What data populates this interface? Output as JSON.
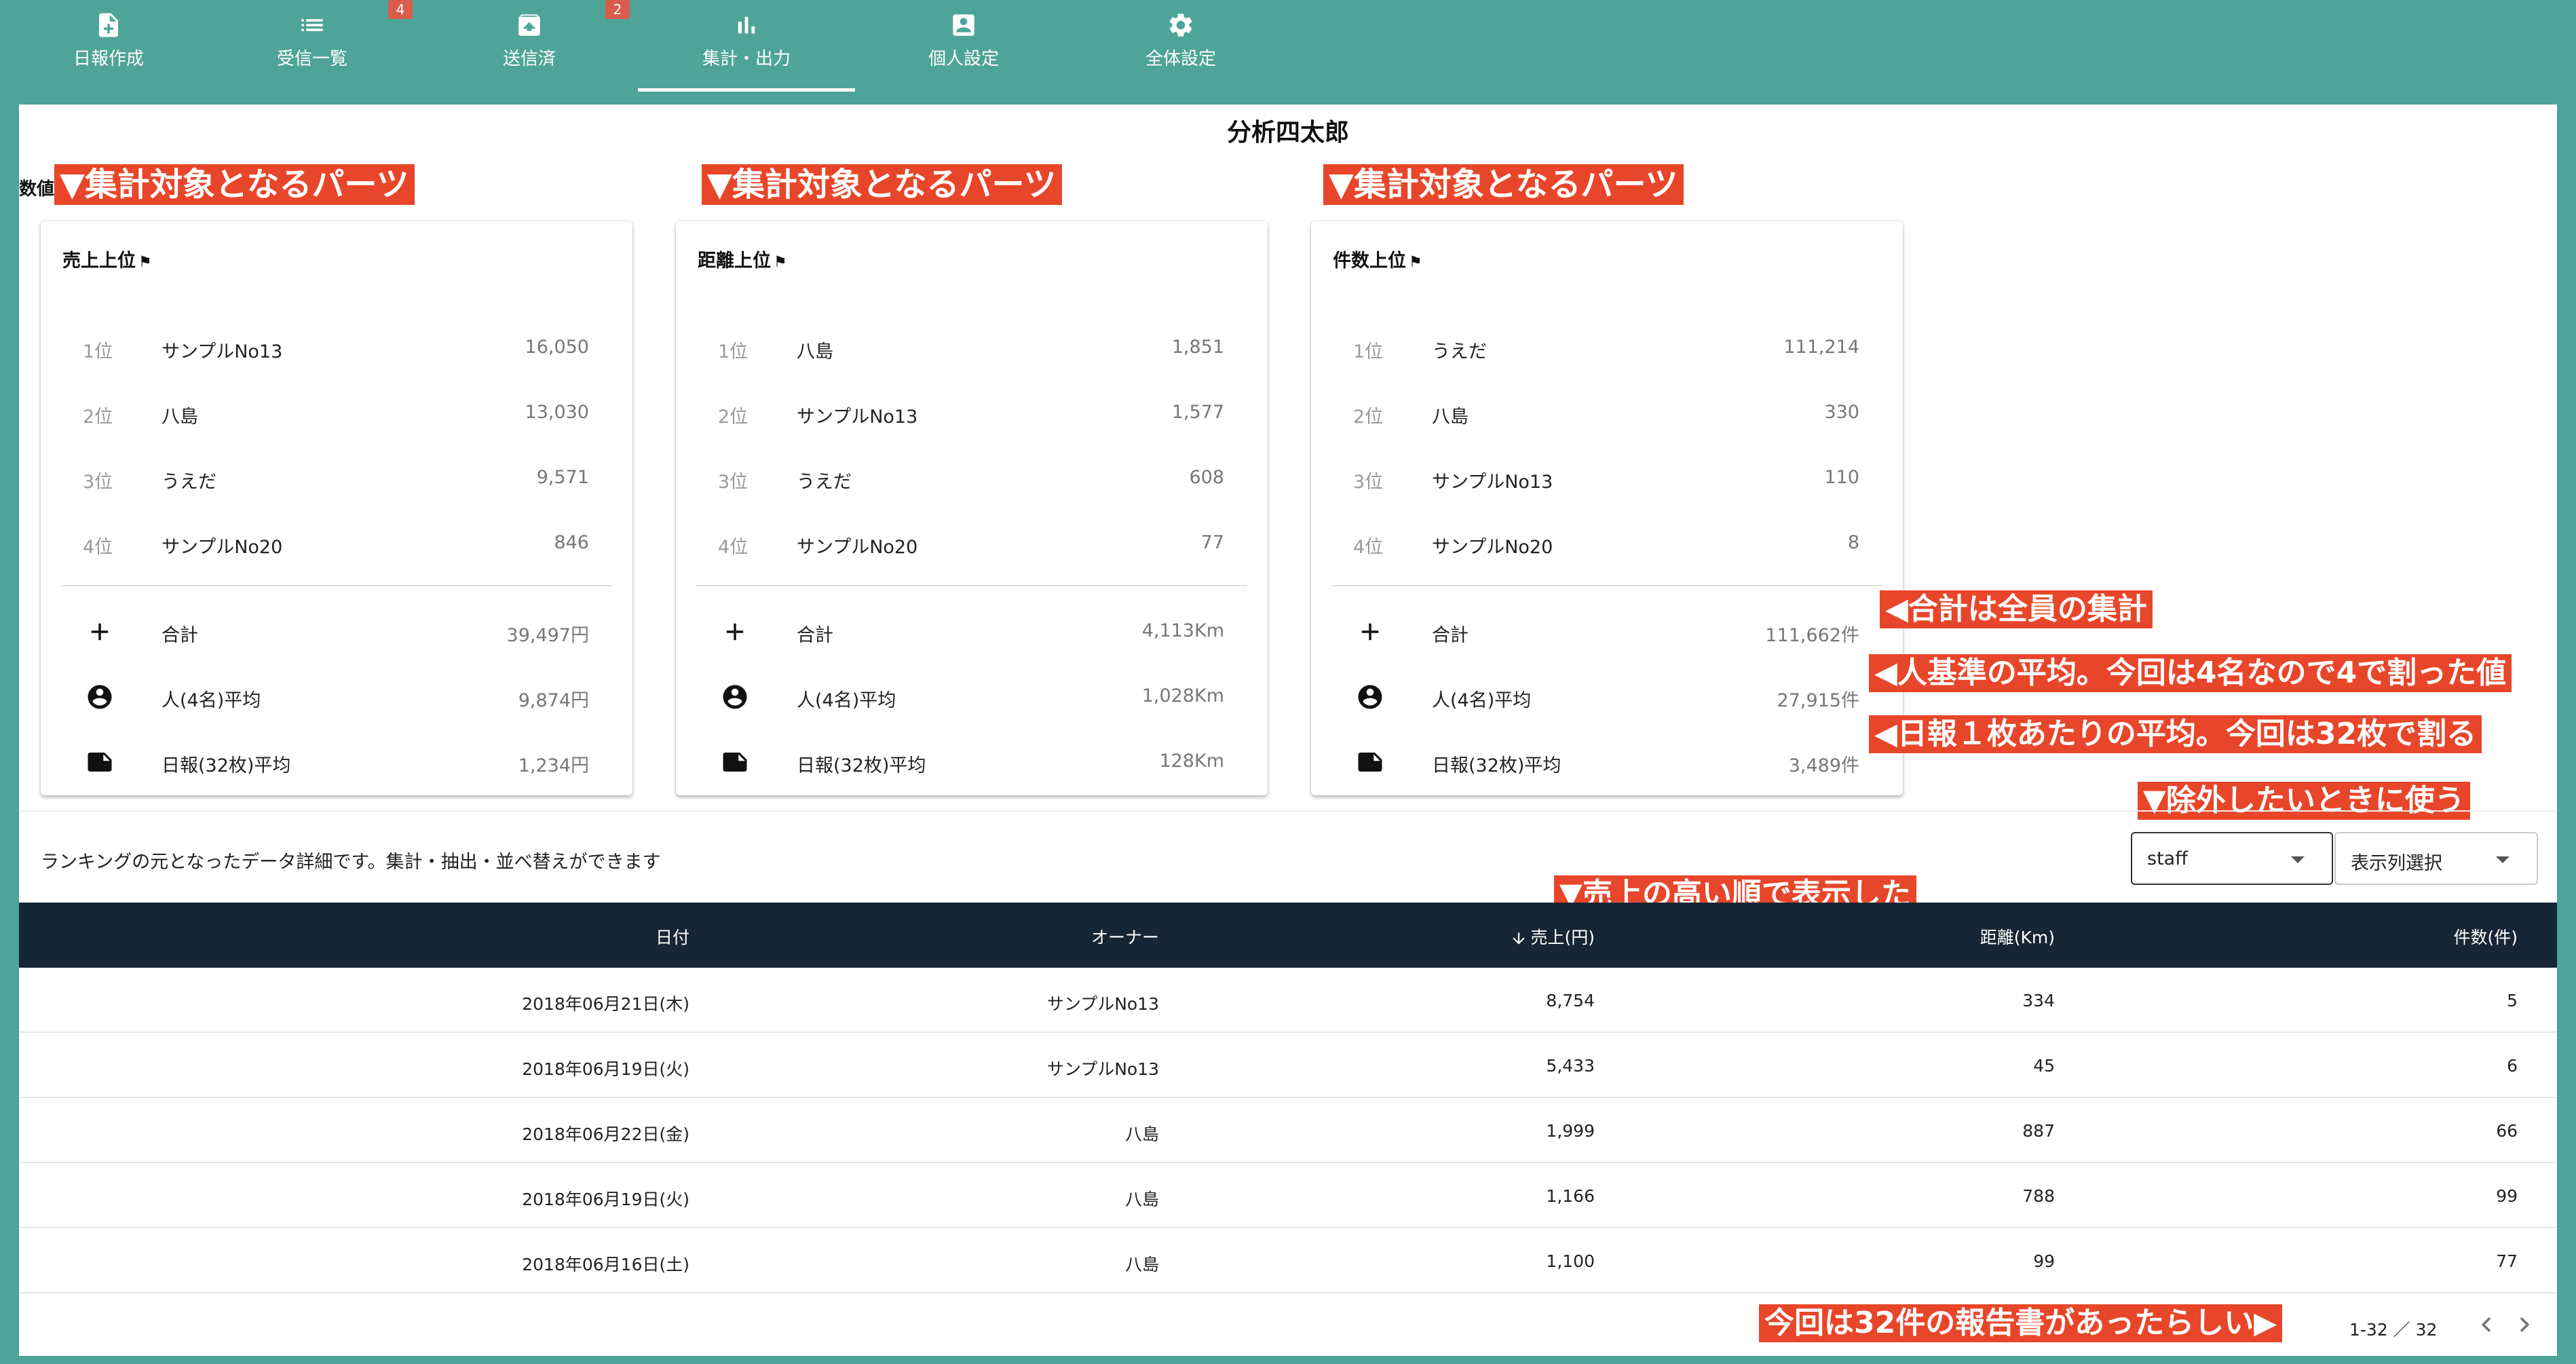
{
  "nav": {
    "items": [
      {
        "label": "日報作成",
        "icon": "note-add-icon"
      },
      {
        "label": "受信一覧",
        "icon": "list-icon",
        "badge": "4"
      },
      {
        "label": "送信済",
        "icon": "archive-icon",
        "badge": "2"
      },
      {
        "label": "集計・出力",
        "icon": "bar-chart-icon",
        "active": true
      },
      {
        "label": "個人設定",
        "icon": "account-box-icon"
      },
      {
        "label": "全体設定",
        "icon": "gear-icon"
      }
    ]
  },
  "page": {
    "title": "分析四太郎",
    "section_label": "数値"
  },
  "annotations": {
    "parts": "▼集計対象となるパーツ",
    "total": "◀合計は全員の集計",
    "person_avg": "◀人基準の平均。今回は4名なので4で割った値",
    "report_avg": "◀日報１枚あたりの平均。今回は32枚で割る",
    "exclude": "▼除外したいときに使う",
    "sorted": "▼売上の高い順で表示した",
    "reports": "今回は32件の報告書があったらしい▶"
  },
  "cards": [
    {
      "title": "売上上位",
      "ranks": [
        {
          "rank": "1位",
          "name": "サンプルNo13",
          "value": "16,050"
        },
        {
          "rank": "2位",
          "name": "八島",
          "value": "13,030"
        },
        {
          "rank": "3位",
          "name": "うえだ",
          "value": "9,571"
        },
        {
          "rank": "4位",
          "name": "サンプルNo20",
          "value": "846"
        }
      ],
      "summary": [
        {
          "label": "合計",
          "value": "39,497円",
          "icon": "plus-icon"
        },
        {
          "label": "人(4名)平均",
          "value": "9,874円",
          "icon": "account-circle-icon"
        },
        {
          "label": "日報(32枚)平均",
          "value": "1,234円",
          "icon": "note-icon"
        }
      ]
    },
    {
      "title": "距離上位",
      "ranks": [
        {
          "rank": "1位",
          "name": "八島",
          "value": "1,851"
        },
        {
          "rank": "2位",
          "name": "サンプルNo13",
          "value": "1,577"
        },
        {
          "rank": "3位",
          "name": "うえだ",
          "value": "608"
        },
        {
          "rank": "4位",
          "name": "サンプルNo20",
          "value": "77"
        }
      ],
      "summary": [
        {
          "label": "合計",
          "value": "4,113Km",
          "icon": "plus-icon"
        },
        {
          "label": "人(4名)平均",
          "value": "1,028Km",
          "icon": "account-circle-icon"
        },
        {
          "label": "日報(32枚)平均",
          "value": "128Km",
          "icon": "note-icon"
        }
      ]
    },
    {
      "title": "件数上位",
      "ranks": [
        {
          "rank": "1位",
          "name": "うえだ",
          "value": "111,214"
        },
        {
          "rank": "2位",
          "name": "八島",
          "value": "330"
        },
        {
          "rank": "3位",
          "name": "サンプルNo13",
          "value": "110"
        },
        {
          "rank": "4位",
          "name": "サンプルNo20",
          "value": "8"
        }
      ],
      "summary": [
        {
          "label": "合計",
          "value": "111,662件",
          "icon": "plus-icon"
        },
        {
          "label": "人(4名)平均",
          "value": "27,915件",
          "icon": "account-circle-icon"
        },
        {
          "label": "日報(32枚)平均",
          "value": "3,489件",
          "icon": "note-icon"
        }
      ]
    }
  ],
  "detail": {
    "description": "ランキングの元となったデータ詳細です。集計・抽出・並べ替えができます",
    "staff_select": "staff",
    "column_select": "表示列選択"
  },
  "table": {
    "headers": {
      "date": "日付",
      "owner": "オーナー",
      "sales": "売上(円)",
      "distance": "距離(Km)",
      "count": "件数(件)"
    },
    "sort_icon": "arrow-down-icon",
    "rows": [
      {
        "date": "2018年06月21日(木)",
        "owner": "サンプルNo13",
        "sales": "8,754",
        "distance": "334",
        "count": "5"
      },
      {
        "date": "2018年06月19日(火)",
        "owner": "サンプルNo13",
        "sales": "5,433",
        "distance": "45",
        "count": "6"
      },
      {
        "date": "2018年06月22日(金)",
        "owner": "八島",
        "sales": "1,999",
        "distance": "887",
        "count": "66"
      },
      {
        "date": "2018年06月19日(火)",
        "owner": "八島",
        "sales": "1,166",
        "distance": "788",
        "count": "99"
      },
      {
        "date": "2018年06月16日(土)",
        "owner": "八島",
        "sales": "1,100",
        "distance": "99",
        "count": "77"
      }
    ]
  },
  "pager": {
    "text": "1-32 ／ 32"
  },
  "colors": {
    "background": "#4ea499",
    "table_header": "#172634",
    "annotation": "#e8462a",
    "badge": "#d95c4c"
  }
}
